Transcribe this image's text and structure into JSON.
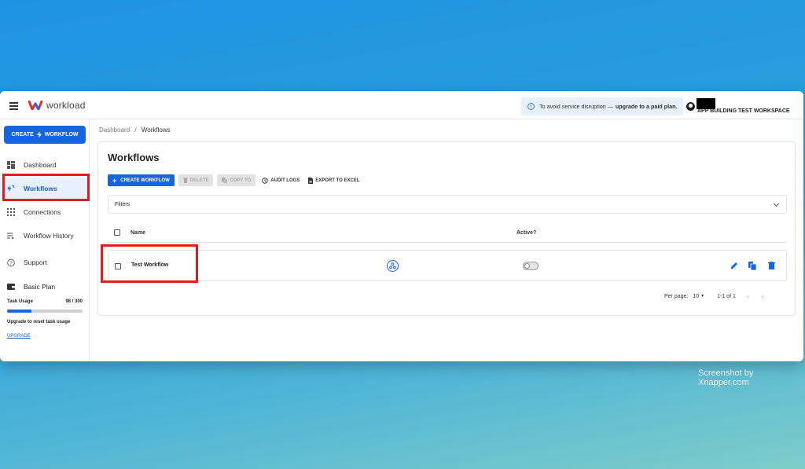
{
  "app": {
    "name": "workload"
  },
  "notice": {
    "text": "To avoid service disruption —",
    "link": "upgrade to a paid plan."
  },
  "account": {
    "workspace": "APP BUILDING TEST WORKSPACE"
  },
  "sidebar": {
    "create_label": "CREATE",
    "create_label_2": "WORKFLOW",
    "items": [
      {
        "label": "Dashboard",
        "icon": "dashboard-icon"
      },
      {
        "label": "Workflows",
        "icon": "workflows-icon",
        "active": true
      },
      {
        "label": "Connections",
        "icon": "grid-icon"
      },
      {
        "label": "Workflow History",
        "icon": "history-list-icon"
      },
      {
        "label": "Support",
        "icon": "help-icon"
      }
    ],
    "plan": "Basic Plan",
    "usage_label": "Task Usage",
    "usage_value": "98 / 300",
    "usage_fraction": 0.3267,
    "reset_text": "Upgrade to reset task usage",
    "upgrade_label": "UPGRADE"
  },
  "breadcrumb": {
    "root": "Dashboard",
    "sep": "/",
    "current": "Workflows"
  },
  "main": {
    "title": "Workflows",
    "toolbar": {
      "create": "CREATE WORKFLOW",
      "delete": "DELETE",
      "copy": "COPY TO",
      "audit": "AUDIT LOGS",
      "export": "EXPORT TO EXCEL"
    },
    "filters_label": "Filters",
    "table": {
      "col_name": "Name",
      "col_active": "Active?",
      "rows": [
        {
          "name": "Test Workflow",
          "active": false
        }
      ]
    },
    "pager": {
      "per_page_label": "Per page:",
      "per_page": "10",
      "range": "1-1 of 1"
    }
  },
  "colors": {
    "accent": "#1565e0",
    "highlight": "#e31b1b",
    "brand_red": "#e32d2d",
    "brand_blue": "#1e6fe0"
  },
  "watermark": "Screenshot by Xnapper.com"
}
